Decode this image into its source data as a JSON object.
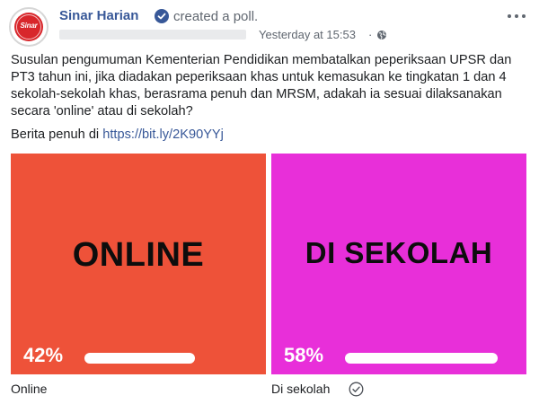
{
  "post": {
    "page_name": "Sinar Harian",
    "avatar_text": "Sinar",
    "action": "created a poll.",
    "timestamp": "Yesterday at 15:53",
    "separator": "·",
    "text": "Susulan pengumuman Kementerian Pendidikan membatalkan peperiksaan UPSR dan PT3 tahun ini, jika diadakan peperiksaan khas untuk kemasukan ke tingkatan 1 dan 4 sekolah-sekolah khas, berasrama penuh dan MRSM, adakah ia sesuai dilaksanakan secara 'online' atau di sekolah?",
    "link_prefix": "Berita penuh di",
    "link_text": "https://bit.ly/2K90YYj"
  },
  "poll": {
    "options": [
      {
        "image_text": "ONLINE",
        "percent_label": "42%",
        "percent": 42,
        "caption": "Online",
        "color": "#ee5239"
      },
      {
        "image_text": "DI SEKOLAH",
        "percent_label": "58%",
        "percent": 58,
        "caption": "Di sekolah",
        "color": "#e82fd9"
      }
    ]
  },
  "colors": {
    "link": "#385898",
    "secondary_text": "#606770",
    "brand_red": "#d8262b"
  },
  "icons": [
    "verified-badge-icon",
    "globe-icon",
    "more-options-icon",
    "check-circle-icon"
  ]
}
